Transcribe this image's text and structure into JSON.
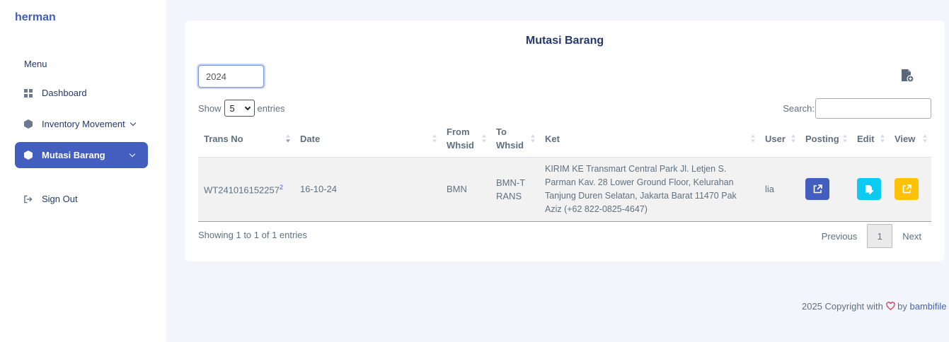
{
  "sidebar": {
    "brand": "herman",
    "menu_title": "Menu",
    "items": [
      {
        "label": "Dashboard",
        "icon": "grid-icon"
      },
      {
        "label": "Inventory Movement",
        "icon": "hexagon-icon"
      },
      {
        "label": "Mutasi Barang",
        "icon": "hexagon-icon",
        "active": true
      },
      {
        "label": "Sign Out",
        "icon": "sign-out-icon"
      }
    ]
  },
  "card": {
    "title": "Mutasi Barang",
    "year_value": "2024",
    "show_label": "Show",
    "page_size": "5",
    "entries_label": "entries",
    "search_label": "Search:",
    "search_value": ""
  },
  "table": {
    "columns": [
      "Trans No",
      "Date",
      "From Whsid",
      "To Whsid",
      "Ket",
      "User",
      "Posting",
      "Edit",
      "View"
    ],
    "rows": [
      {
        "trans_no": "WT241016152257",
        "count": "2",
        "date": "16-10-24",
        "from": "BMN",
        "to": "BMN-TRANS",
        "ket": "KIRIM KE Transmart Central Park Jl. Letjen S. Parman Kav. 28 Lower Ground Floor, Kelurahan Tanjung Duren Selatan, Jakarta Barat 11470 Pak Aziz (+62 822-0825-4647)",
        "user": "lia"
      }
    ]
  },
  "footer_info": "Showing 1 to 1 of 1 entries",
  "pagination": {
    "previous": "Previous",
    "current": "1",
    "next": "Next"
  },
  "copyright": {
    "text": "2025 Copyright with",
    "by": "by",
    "author": "bambifile"
  },
  "colors": {
    "primary": "#435ebe",
    "info": "#0dcaf0",
    "warning": "#ffc107",
    "heart": "#dc3545"
  }
}
